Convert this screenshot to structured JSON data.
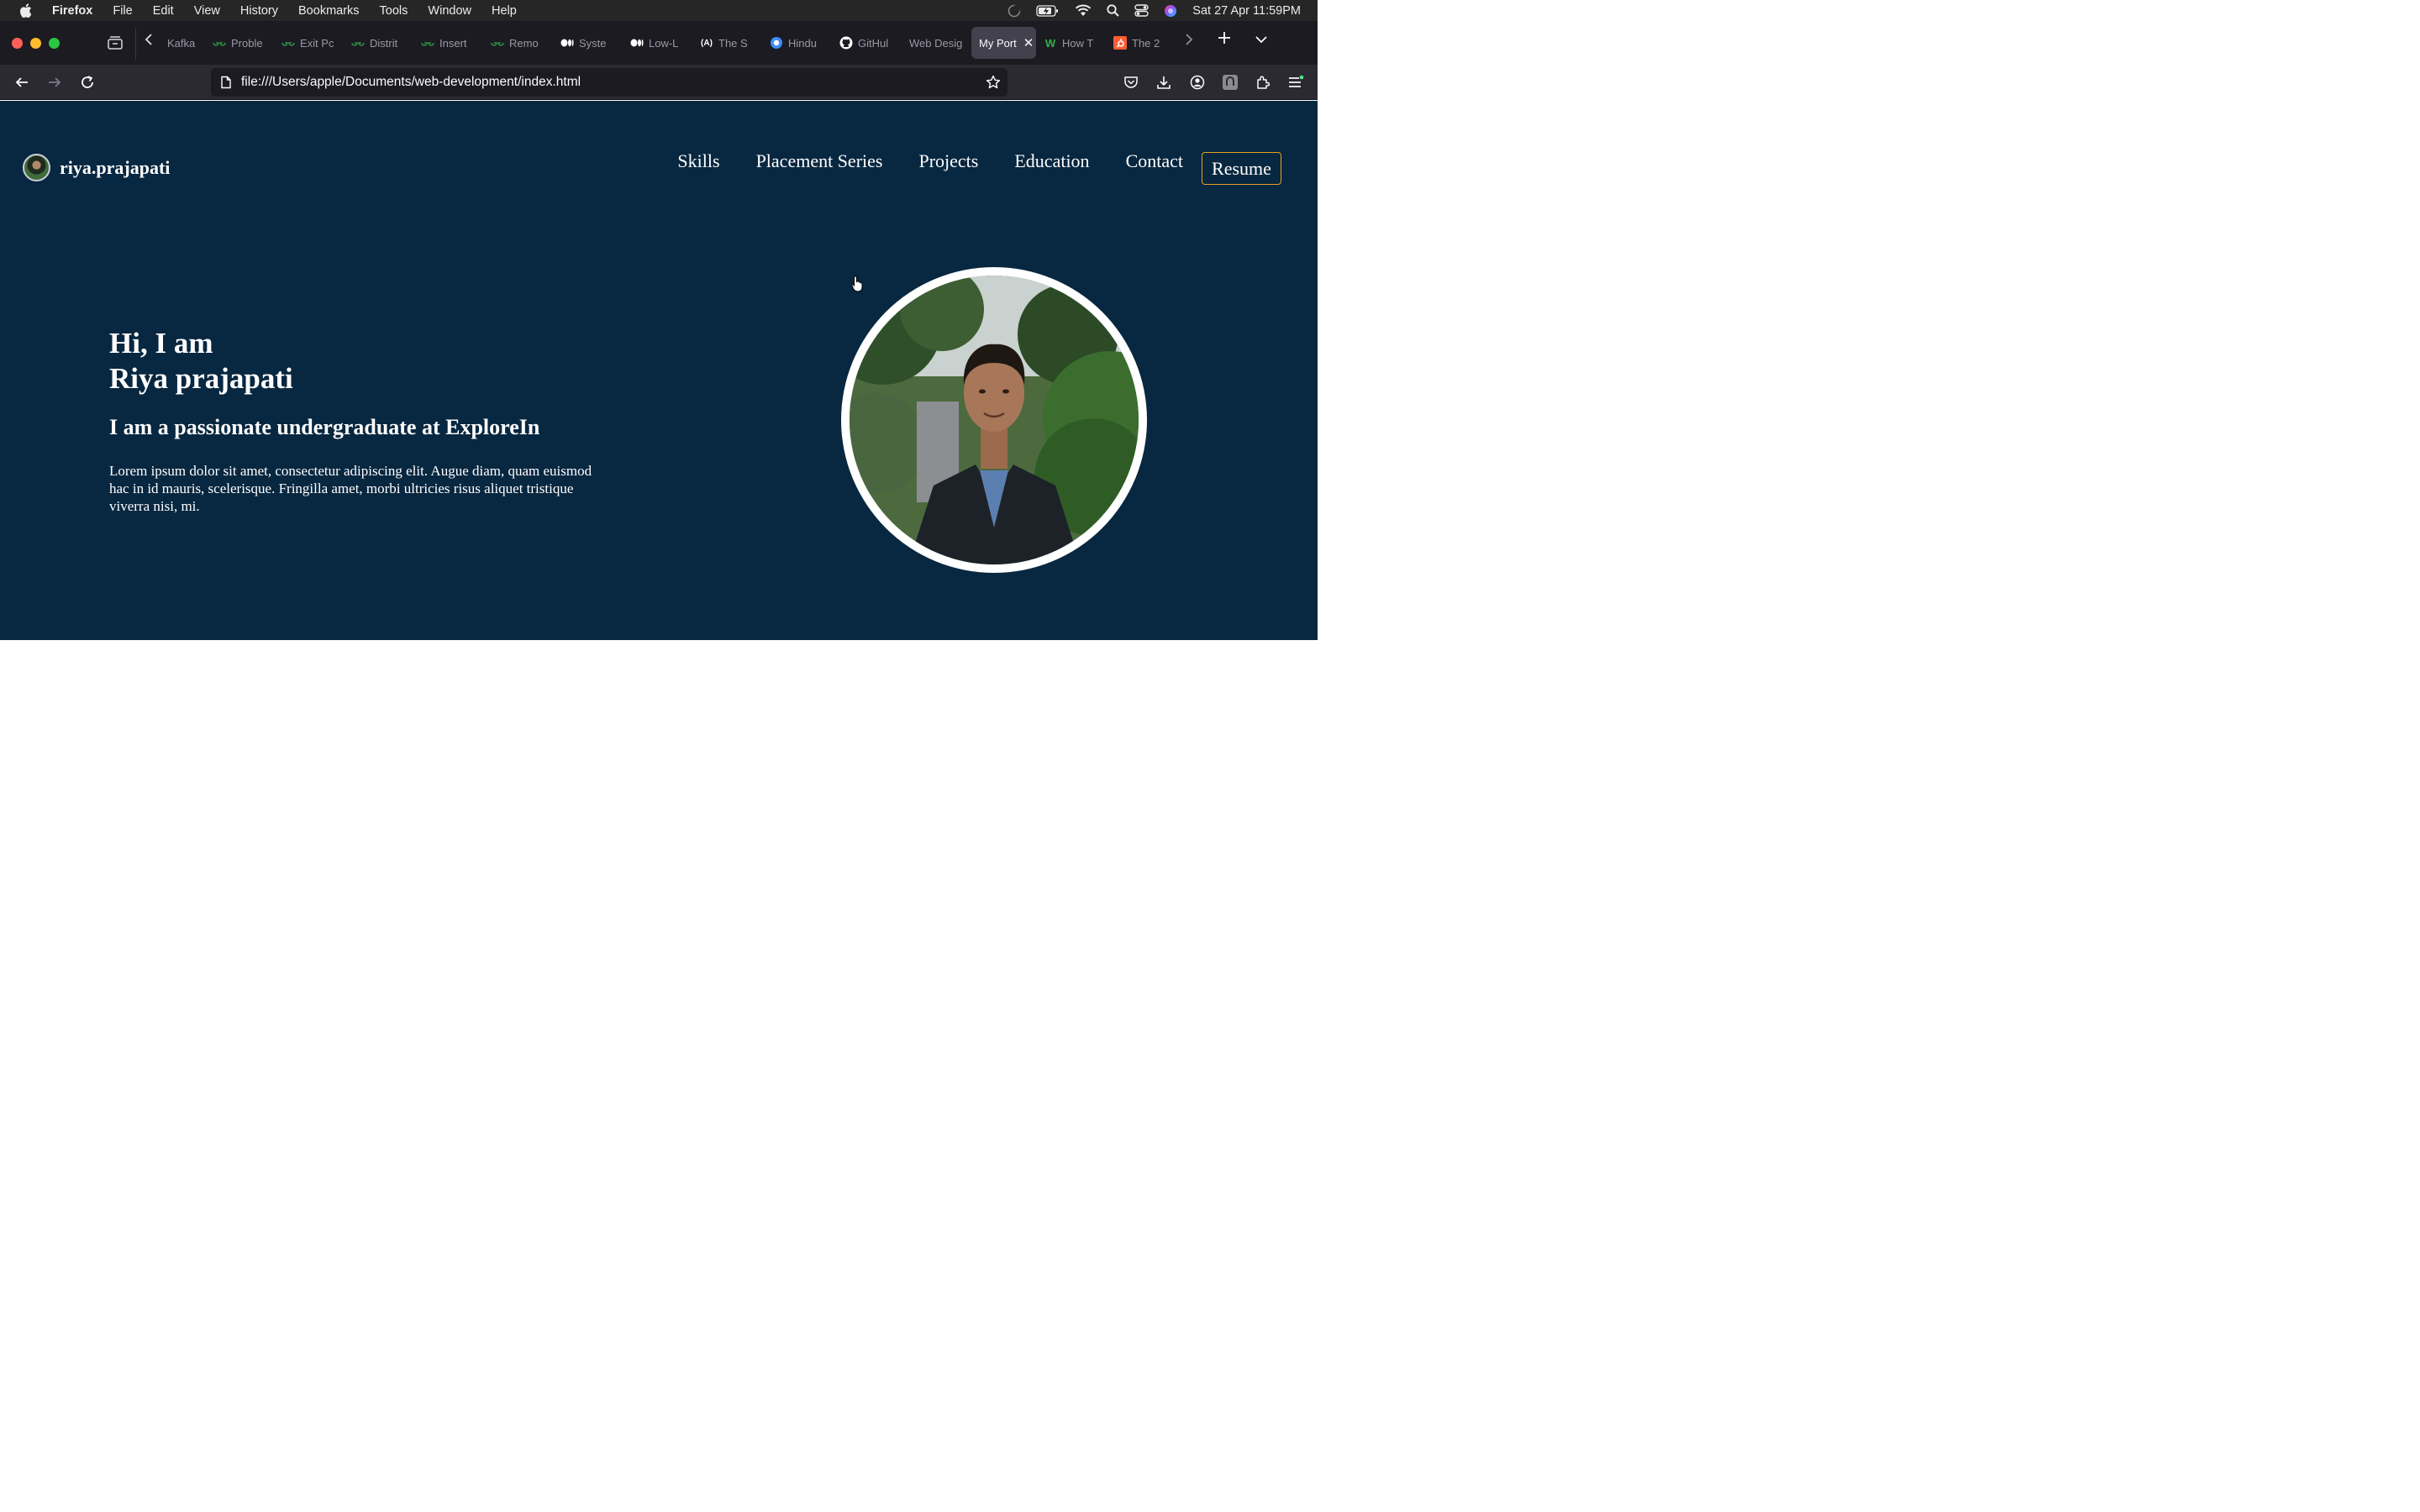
{
  "menubar": {
    "app_name": "Firefox",
    "items": [
      "File",
      "Edit",
      "View",
      "History",
      "Bookmarks",
      "Tools",
      "Window",
      "Help"
    ],
    "clock": "Sat 27 Apr  11:59PM"
  },
  "tabs": [
    {
      "label": "Kafka",
      "icon": "kafka-icon"
    },
    {
      "label": "Proble",
      "icon": "gfg-icon"
    },
    {
      "label": "Exit Pc",
      "icon": "gfg-icon"
    },
    {
      "label": "Distrit",
      "icon": "gfg-icon"
    },
    {
      "label": "Insert",
      "icon": "gfg-icon"
    },
    {
      "label": "Remo",
      "icon": "gfg-icon"
    },
    {
      "label": "Syste",
      "icon": "medium-icon"
    },
    {
      "label": "Low-L",
      "icon": "medium-icon"
    },
    {
      "label": "The S",
      "icon": "code-icon"
    },
    {
      "label": "Hindu",
      "icon": "circle-icon"
    },
    {
      "label": "GitHul",
      "icon": "github-icon"
    },
    {
      "label": "Web Desig",
      "icon": "none"
    },
    {
      "label": "My Port",
      "icon": "none",
      "active": true
    },
    {
      "label": "How T",
      "icon": "wellfound-icon"
    },
    {
      "label": "The 2",
      "icon": "hubspot-icon"
    }
  ],
  "url": "file:///Users/apple/Documents/web-development/index.html",
  "site": {
    "brand": "riya.prajapati",
    "nav": [
      "Skills",
      "Placement Series",
      "Projects",
      "Education",
      "Contact"
    ],
    "resume": "Resume",
    "greeting_line1": "Hi, I am",
    "greeting_line2": "Riya prajapati",
    "subtitle": "I am a passionate undergraduate at ExploreIn",
    "description": "Lorem ipsum dolor sit amet, consectetur adipiscing elit. Augue diam, quam euismod hac in id mauris, scelerisque. Fringilla amet, morbi ultricies risus aliquet tristique viverra nisi, mi."
  },
  "colors": {
    "page_bg": "#082740",
    "resume_border": "#e5a526",
    "tab_active": "#42414d"
  }
}
